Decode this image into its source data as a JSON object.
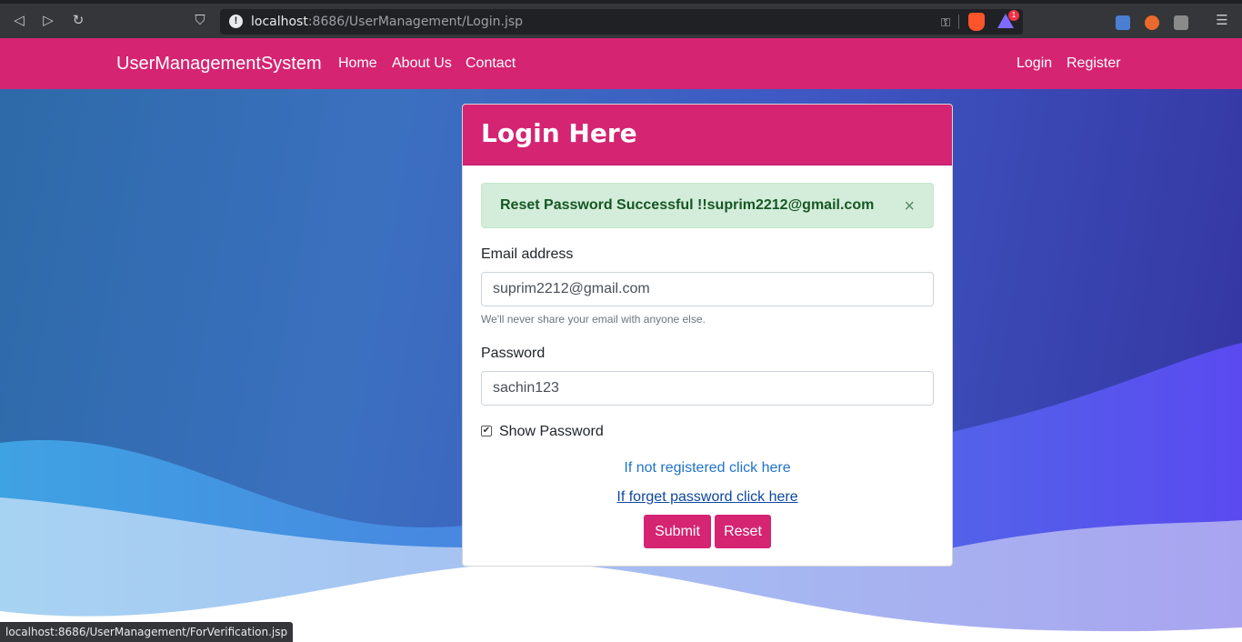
{
  "browser": {
    "url_host": "localhost",
    "url_rest": ":8686/UserManagement/Login.jsp",
    "rewards_badge": "1",
    "status_url": "localhost:8686/UserManagement/ForVerification.jsp"
  },
  "navbar": {
    "brand": "UserManagementSystem",
    "links": [
      "Home",
      "About Us",
      "Contact"
    ],
    "right_links": [
      "Login",
      "Register"
    ]
  },
  "card": {
    "title": "Login Here",
    "alert": "Reset Password Successful !!suprim2212@gmail.com",
    "alert_close": "×",
    "email_label": "Email address",
    "email_value": "suprim2212@gmail.com",
    "email_help": "We'll never share your email with anyone else.",
    "password_label": "Password",
    "password_value": "sachin123",
    "show_password_label": "Show Password",
    "show_password_checked": true,
    "register_link": "If not registered click here",
    "forgot_link": "If forget password click here",
    "submit_label": "Submit",
    "reset_label": "Reset"
  },
  "colors": {
    "primary": "#d42472",
    "alert_bg": "#d4edda",
    "link": "#1f73c7"
  }
}
